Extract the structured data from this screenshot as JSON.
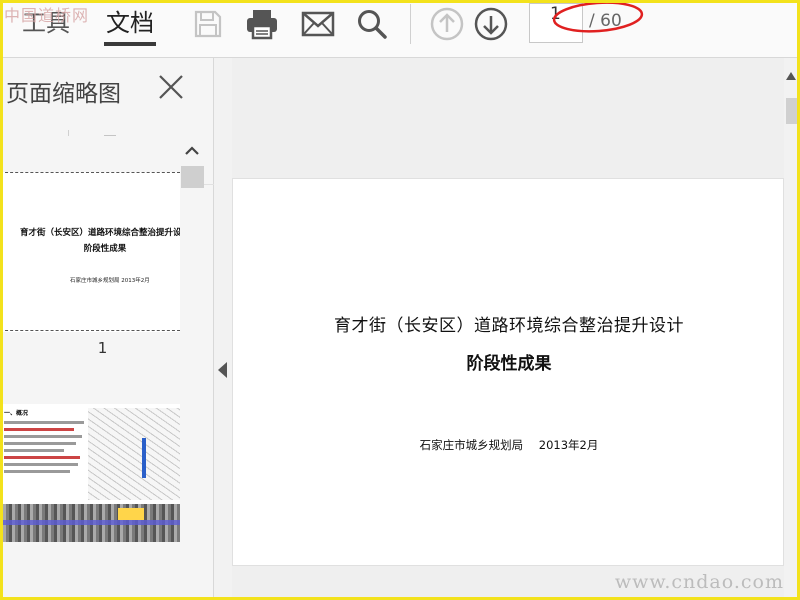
{
  "toolbar": {
    "tabs": [
      {
        "label": "工具"
      },
      {
        "label": "文档",
        "active": true
      }
    ],
    "buttons": [
      "save-icon",
      "print-icon",
      "email-icon",
      "search-icon",
      "previous-page-icon",
      "next-page-icon"
    ],
    "page_current": "1",
    "page_total": "/ 60"
  },
  "watermarks": {
    "top_left": "中国道桥网",
    "bottom_right": "www.cndao.com"
  },
  "sidebar": {
    "title": "页面缩略图",
    "tools": [
      "page-options-icon",
      "delete-page-icon",
      "extract-page-icon"
    ],
    "thumbnails": [
      {
        "page_number": "1",
        "title": "育才街（长安区）道路环境综合整治提升设计",
        "subtitle": "阶段性成果",
        "footer": "石家庄市城乡规划局    2013年2月"
      },
      {
        "heading": "一、概况"
      }
    ]
  },
  "document": {
    "title": "育才街（长安区）道路环境综合整治提升设计",
    "subtitle": "阶段性成果",
    "footer_org": "石家庄市城乡规划局",
    "footer_date": "2013年2月"
  },
  "colors": {
    "frame": "#f3e21c",
    "annotation": "#e02020",
    "toolbar_bg": "#fafafa",
    "page_bg": "#ffffff"
  }
}
